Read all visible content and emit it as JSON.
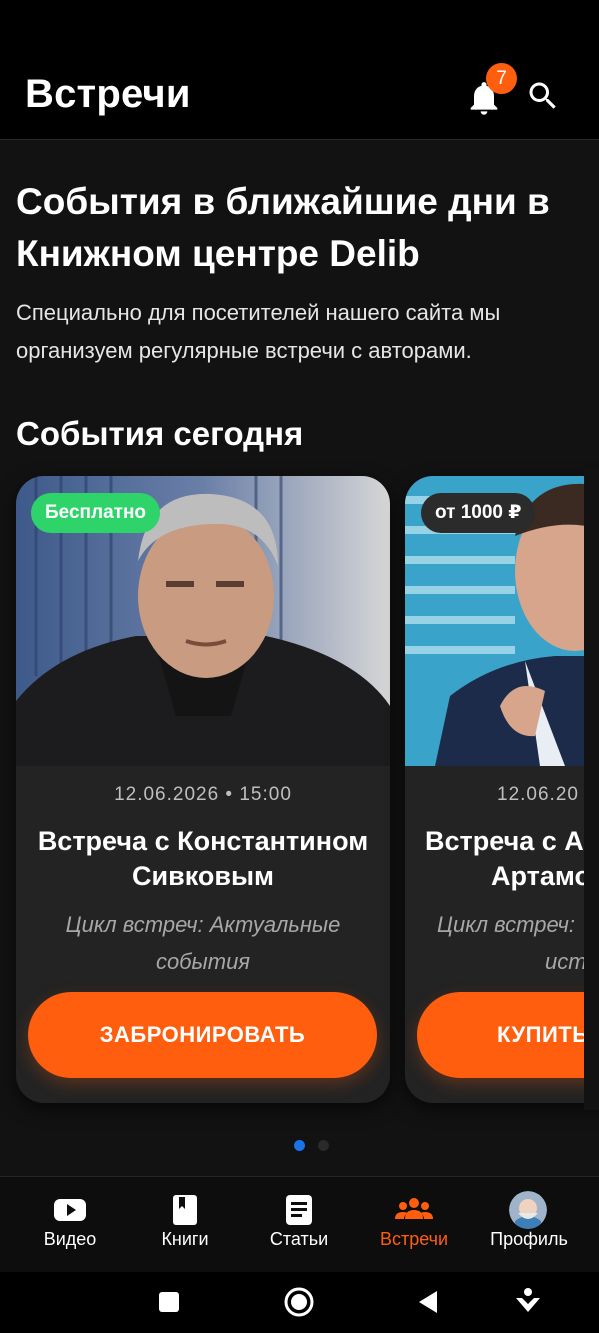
{
  "header": {
    "title": "Встречи",
    "notifications_count": "7"
  },
  "hero": {
    "title": "События в ближайшие дни в Книжном центре Delib",
    "description": "Специально для посетителей нашего сайта мы организуем регулярные встречи с авторами."
  },
  "section": {
    "title": "События сегодня"
  },
  "events": [
    {
      "price": "Бесплатно",
      "date": "12.06.2026 • 15:00",
      "title": "Встреча с Константином Сивковым",
      "subtitle": "Цикл встреч: Актуальные события",
      "button": "ЗАБРОНИРОВАТЬ"
    },
    {
      "price": "от 1000 ₽",
      "date": "12.06.20",
      "title_line1": "Встреча с А",
      "title_line2": "Артамо",
      "subtitle_line1": "Цикл встреч:",
      "subtitle_line2": "ист",
      "button": "КУПИТЬ"
    }
  ],
  "pager": {
    "count": 2,
    "active": 1
  },
  "bottom_nav": {
    "items": [
      {
        "label": "Видео",
        "icon": "video-icon"
      },
      {
        "label": "Книги",
        "icon": "book-icon"
      },
      {
        "label": "Статьи",
        "icon": "article-icon"
      },
      {
        "label": "Встречи",
        "icon": "people-icon",
        "active": true
      },
      {
        "label": "Профиль",
        "icon": "avatar"
      }
    ]
  },
  "colors": {
    "accent": "#ff5e0e",
    "free_badge": "#2ed46a",
    "pager_active": "#1a73e8",
    "background": "#121212"
  }
}
